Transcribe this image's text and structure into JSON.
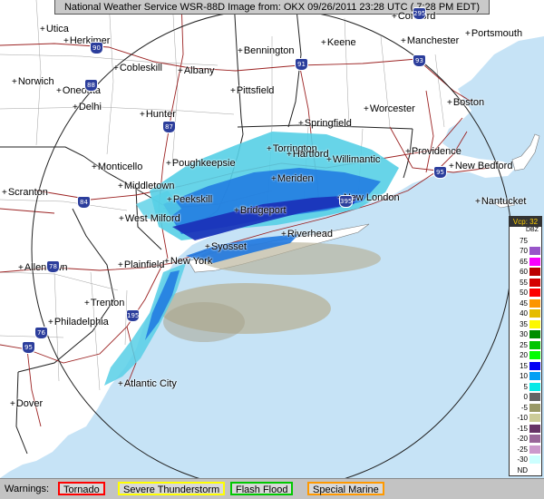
{
  "header": {
    "title": "National Weather Service WSR-88D Image from: OKX 09/26/2011 23:28 UTC ( 7:28 PM EDT)"
  },
  "colors": {
    "ocean": "#c6e3f6",
    "land": "#ffffff",
    "light_rain": "#57cfe6",
    "rain": "#1f78e0",
    "heavy": "#1a2fb8",
    "clutter": "#b7b197"
  },
  "cities": [
    {
      "name": "Utica"
    },
    {
      "name": "Herkimer"
    },
    {
      "name": "Norwich"
    },
    {
      "name": "Oneonta"
    },
    {
      "name": "Cobleskill"
    },
    {
      "name": "Albany"
    },
    {
      "name": "Delhi"
    },
    {
      "name": "Hunter"
    },
    {
      "name": "Bennington"
    },
    {
      "name": "Keene"
    },
    {
      "name": "Concord"
    },
    {
      "name": "Manchester"
    },
    {
      "name": "Portsmouth"
    },
    {
      "name": "Pittsfield"
    },
    {
      "name": "Worcester"
    },
    {
      "name": "Boston"
    },
    {
      "name": "Springfield"
    },
    {
      "name": "Monticello"
    },
    {
      "name": "Poughkeepsie"
    },
    {
      "name": "Torrington"
    },
    {
      "name": "Hartford"
    },
    {
      "name": "Willimantic"
    },
    {
      "name": "Providence"
    },
    {
      "name": "New Bedford"
    },
    {
      "name": "Nantucket"
    },
    {
      "name": "Scranton"
    },
    {
      "name": "Middletown"
    },
    {
      "name": "Meriden"
    },
    {
      "name": "New London"
    },
    {
      "name": "Peekskill"
    },
    {
      "name": "West Milford"
    },
    {
      "name": "Bridgeport"
    },
    {
      "name": "Riverhead"
    },
    {
      "name": "Syosset"
    },
    {
      "name": "Allentown"
    },
    {
      "name": "Plainfield"
    },
    {
      "name": "New York"
    },
    {
      "name": "Trenton"
    },
    {
      "name": "Philadelphia"
    },
    {
      "name": "Dover"
    },
    {
      "name": "Atlantic City"
    }
  ],
  "highways": [
    "90",
    "88",
    "91",
    "93",
    "87",
    "84",
    "95",
    "195",
    "78",
    "76",
    "95",
    "395",
    "295"
  ],
  "legend": {
    "header": "Vcp: 32",
    "unit": "DBZ",
    "levels": [
      {
        "value": "75",
        "color": "#ffffff"
      },
      {
        "value": "70",
        "color": "#9855c9"
      },
      {
        "value": "65",
        "color": "#f800fd"
      },
      {
        "value": "60",
        "color": "#bc0000"
      },
      {
        "value": "55",
        "color": "#d40000"
      },
      {
        "value": "50",
        "color": "#fd0000"
      },
      {
        "value": "45",
        "color": "#fd9500"
      },
      {
        "value": "40",
        "color": "#e5bc00"
      },
      {
        "value": "35",
        "color": "#fdf802"
      },
      {
        "value": "30",
        "color": "#008e00"
      },
      {
        "value": "25",
        "color": "#01c501"
      },
      {
        "value": "20",
        "color": "#02fd02"
      },
      {
        "value": "15",
        "color": "#0300f4"
      },
      {
        "value": "10",
        "color": "#019ff4"
      },
      {
        "value": "5",
        "color": "#04e9e7"
      },
      {
        "value": "0",
        "color": "#646464"
      },
      {
        "value": "-5",
        "color": "#999966"
      },
      {
        "value": "-10",
        "color": "#cccc99"
      },
      {
        "value": "-15",
        "color": "#663366"
      },
      {
        "value": "-20",
        "color": "#996699"
      },
      {
        "value": "-25",
        "color": "#cc99cc"
      },
      {
        "value": "-30",
        "color": "#ccffff"
      },
      {
        "value": "ND",
        "color": "#ffffff"
      }
    ]
  },
  "warnings": {
    "label": "Warnings:",
    "items": [
      {
        "label": "Tornado",
        "color": "#ff0000"
      },
      {
        "label": "Severe Thunderstorm",
        "color": "#ffff00"
      },
      {
        "label": "Flash Flood",
        "color": "#00c800"
      },
      {
        "label": "Special Marine",
        "color": "#ff9900"
      }
    ]
  }
}
